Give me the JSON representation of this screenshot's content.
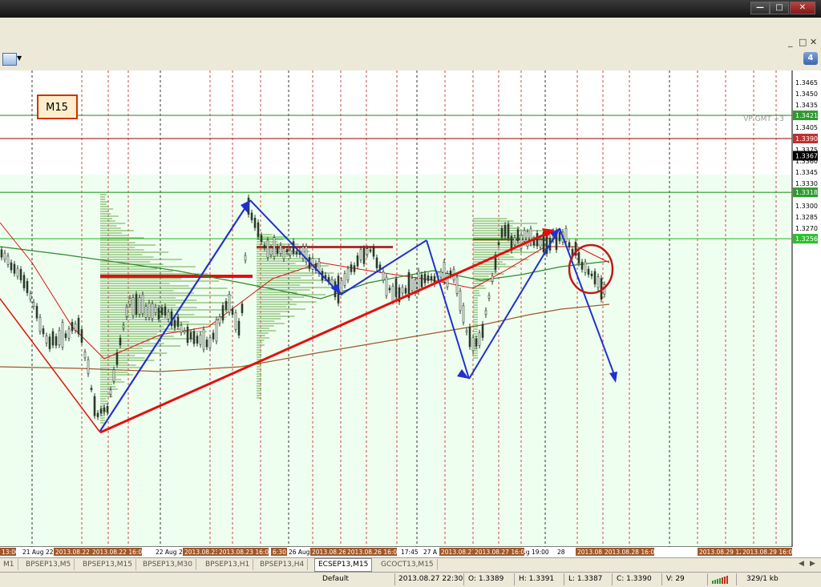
{
  "window": {
    "buttons": [
      "—",
      "□",
      "✕"
    ],
    "inner_buttons": [
      "_",
      "□",
      "✕"
    ]
  },
  "toolbar": {
    "badge": "4"
  },
  "chart": {
    "timeframe_label": "M15",
    "indicator_label": "VP GMT +3",
    "price_labels": [
      "1.3465",
      "1.3450",
      "1.3435",
      "1.3405",
      "1.3375",
      "1.3360",
      "1.3345",
      "1.3330",
      "1.3315",
      "1.3300",
      "1.3285",
      "1.3270"
    ],
    "hline_prices": [
      "1.3421",
      "1.3390",
      "1.3367",
      "1.3318",
      "1.3256"
    ],
    "time_labels": [
      "21 Aug 22:",
      "22 Aug 2",
      "26 Aug",
      "17:45",
      "27 A",
      "Aug 19:00",
      "28"
    ],
    "date_tags": [
      "13:00",
      "2013.08.22 12:00",
      "2013.08.22 16:00",
      "2013.08.23 12:00",
      "2013.08.23 16:00",
      "6:30",
      "2013.08.26 12:00",
      "2013.08.26 16:00",
      "2013.08.27 12:00",
      "2013.08.27 16:00",
      "2013.08.28 12:00",
      "2013.08.28 16:00",
      "2013.08.29 12:00",
      "2013.08.29 16:00"
    ]
  },
  "tabs": {
    "items": [
      "M1",
      "BPSEP13,M5",
      "BPSEP13,M15",
      "BPSEP13,M30",
      "BPSEP13,H1",
      "BPSEP13,H4",
      "ECSEP13,M15",
      "GCOCT13,M15"
    ],
    "active": 6
  },
  "status": {
    "profile": "Default",
    "datetime": "2013.08.27 22:30",
    "open": "O: 1.3389",
    "high": "H: 1.3391",
    "low": "L: 1.3387",
    "close": "C: 1.3390",
    "volume": "V: 29",
    "traffic": "329/1 kb"
  },
  "colors": {
    "chart_bg": "#efffef",
    "upper_band": "#ffffff",
    "support_line": "#2e9a2e",
    "resistance_line": "#b03030",
    "trend_red": "#e01010",
    "wave_blue": "#2030d0",
    "profile_green": "#6aa84f"
  }
}
